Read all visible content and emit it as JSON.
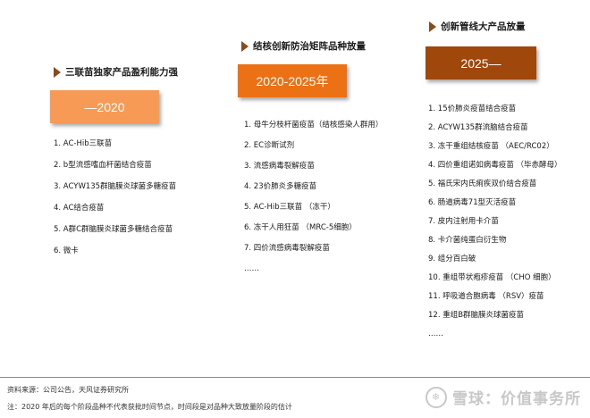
{
  "columns": [
    {
      "heading": "三联苗独家产品盈利能力强",
      "box_label": "—2020",
      "box_color": "#f69a55",
      "items": [
        "1. AC-Hib三联苗",
        "2. b型流感嗜血杆菌结合疫苗",
        "3. ACYW135群脑膜炎球菌多糖疫苗",
        "4. AC结合疫苗",
        "5. A群C群脑膜炎球菌多糖结合疫苗",
        "6. 微卡"
      ]
    },
    {
      "heading": "结核创新防治矩阵品种放量",
      "box_label": "2020-2025年",
      "box_color": "#ec7014",
      "items": [
        "1. 母牛分枝杆菌疫苗（结核感染人群用）",
        "2. EC诊断试剂",
        "3. 流感病毒裂解疫苗",
        "4. 23价肺炎多糖疫苗",
        "5. AC-Hib三联苗 （冻干）",
        "6. 冻干人用狂苗 （MRC-5细胞）",
        "7. 四价流感病毒裂解疫苗",
        "……"
      ]
    },
    {
      "heading": "创新管线大产品放量",
      "box_label": "2025—",
      "box_color": "#a0480c",
      "items": [
        "1. 15价肺炎疫苗结合疫苗",
        "2. ACYW135群流脑结合疫苗",
        "3. 冻干重组结核疫苗 （AEC/RC02）",
        "4. 四价重组诺如病毒疫苗 （毕赤酵母）",
        "5. 福氏宋内氏痢疾双价结合疫苗",
        "6. 肠道病毒71型灭活疫苗",
        "7. 皮内注射用卡介苗",
        "8. 卡介菌纯蛋白衍生物",
        "9. 组分百白破",
        "10. 重组带状疱疹疫苗 （CHO 细胞）",
        "11. 呼吸道合胞病毒 （RSV）疫苗",
        "12. 重组B群脑膜炎球菌疫苗",
        "……"
      ]
    }
  ],
  "footer": {
    "source": "资料来源：公司公告，天风证券研究所",
    "note": "注：2020 年后的每个阶段品种不代表获批时间节点，时间段是对品种大致放量阶段的估计"
  },
  "watermark": "雪球：价值事务所"
}
